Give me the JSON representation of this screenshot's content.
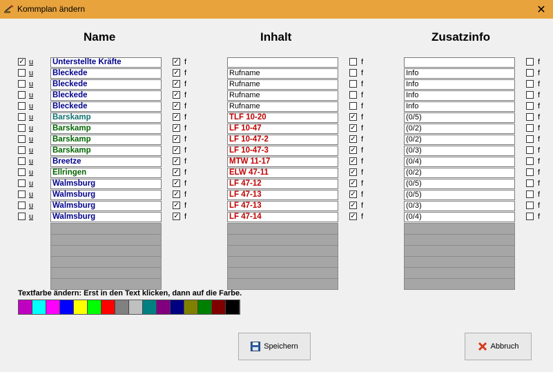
{
  "window": {
    "title": "Kommplan ändern",
    "close": "✕"
  },
  "headers": {
    "name": "Name",
    "inhalt": "Inhalt",
    "zusatzinfo": "Zusatzinfo"
  },
  "u_label": "u",
  "f_label": "f",
  "colors": {
    "navy": "#00008b",
    "teal": "#107070",
    "green": "#006400",
    "red": "#c00000",
    "black": "#000000"
  },
  "rows": [
    {
      "u": true,
      "name": "Unterstellte Kräfte",
      "name_color": "navy",
      "name_f": true,
      "inhalt": "",
      "inhalt_bold": false,
      "inhalt_f": false,
      "zusatz": "",
      "zusatz_f": false
    },
    {
      "u": false,
      "name": "Bleckede",
      "name_color": "navy",
      "name_f": true,
      "inhalt": "Rufname",
      "inhalt_bold": false,
      "inhalt_f": false,
      "zusatz": "Info",
      "zusatz_f": false
    },
    {
      "u": false,
      "name": "Bleckede",
      "name_color": "navy",
      "name_f": true,
      "inhalt": "Rufname",
      "inhalt_bold": false,
      "inhalt_f": false,
      "zusatz": "Info",
      "zusatz_f": false
    },
    {
      "u": false,
      "name": "Bleckede",
      "name_color": "navy",
      "name_f": true,
      "inhalt": "Rufname",
      "inhalt_bold": false,
      "inhalt_f": false,
      "zusatz": "Info",
      "zusatz_f": false
    },
    {
      "u": false,
      "name": "Bleckede",
      "name_color": "navy",
      "name_f": true,
      "inhalt": "Rufname",
      "inhalt_bold": false,
      "inhalt_f": false,
      "zusatz": "Info",
      "zusatz_f": false
    },
    {
      "u": false,
      "name": "Barskamp",
      "name_color": "teal",
      "name_f": true,
      "inhalt": "TLF 10-20",
      "inhalt_bold": true,
      "inhalt_f": true,
      "zusatz": "(0/5)",
      "zusatz_f": false
    },
    {
      "u": false,
      "name": "Barskamp",
      "name_color": "green",
      "name_f": true,
      "inhalt": "LF 10-47",
      "inhalt_bold": true,
      "inhalt_f": true,
      "zusatz": "(0/2)",
      "zusatz_f": false
    },
    {
      "u": false,
      "name": "Barskamp",
      "name_color": "green",
      "name_f": true,
      "inhalt": "LF 10-47-2",
      "inhalt_bold": true,
      "inhalt_f": true,
      "zusatz": "(0/2)",
      "zusatz_f": false
    },
    {
      "u": false,
      "name": "Barskamp",
      "name_color": "green",
      "name_f": true,
      "inhalt": "LF 10-47-3",
      "inhalt_bold": true,
      "inhalt_f": true,
      "zusatz": "(0/3)",
      "zusatz_f": false
    },
    {
      "u": false,
      "name": "Breetze",
      "name_color": "navy",
      "name_f": true,
      "inhalt": "MTW 11-17",
      "inhalt_bold": true,
      "inhalt_f": true,
      "zusatz": "(0/4)",
      "zusatz_f": false
    },
    {
      "u": false,
      "name": "Ellringen",
      "name_color": "green",
      "name_f": true,
      "inhalt": "ELW 47-11",
      "inhalt_bold": true,
      "inhalt_f": true,
      "zusatz": "(0/2)",
      "zusatz_f": false
    },
    {
      "u": false,
      "name": "Walmsburg",
      "name_color": "navy",
      "name_f": true,
      "inhalt": "LF 47-12",
      "inhalt_bold": true,
      "inhalt_f": true,
      "zusatz": "(0/5)",
      "zusatz_f": false
    },
    {
      "u": false,
      "name": "Walmsburg",
      "name_color": "navy",
      "name_f": true,
      "inhalt": "LF 47-13",
      "inhalt_bold": true,
      "inhalt_f": true,
      "zusatz": "(0/5)",
      "zusatz_f": false
    },
    {
      "u": false,
      "name": "Walmsburg",
      "name_color": "navy",
      "name_f": true,
      "inhalt": "LF 47-13",
      "inhalt_bold": true,
      "inhalt_f": true,
      "zusatz": "(0/3)",
      "zusatz_f": false
    },
    {
      "u": false,
      "name": "Walmsburg",
      "name_color": "navy",
      "name_f": true,
      "inhalt": "LF 47-14",
      "inhalt_bold": true,
      "inhalt_f": true,
      "zusatz": "(0/4)",
      "zusatz_f": false
    }
  ],
  "empty_rows": 6,
  "hint": "Textfarbe ändern: Erst in den Text klicken, dann auf die Farbe.",
  "palette": [
    "#c000c0",
    "#00ffff",
    "#ff00ff",
    "#0000ff",
    "#ffff00",
    "#00ff00",
    "#ff0000",
    "#808080",
    "#c0c0c0",
    "#008080",
    "#800080",
    "#000080",
    "#808000",
    "#008000",
    "#800000",
    "#000000"
  ],
  "buttons": {
    "save": "Speichern",
    "cancel": "Abbruch"
  }
}
